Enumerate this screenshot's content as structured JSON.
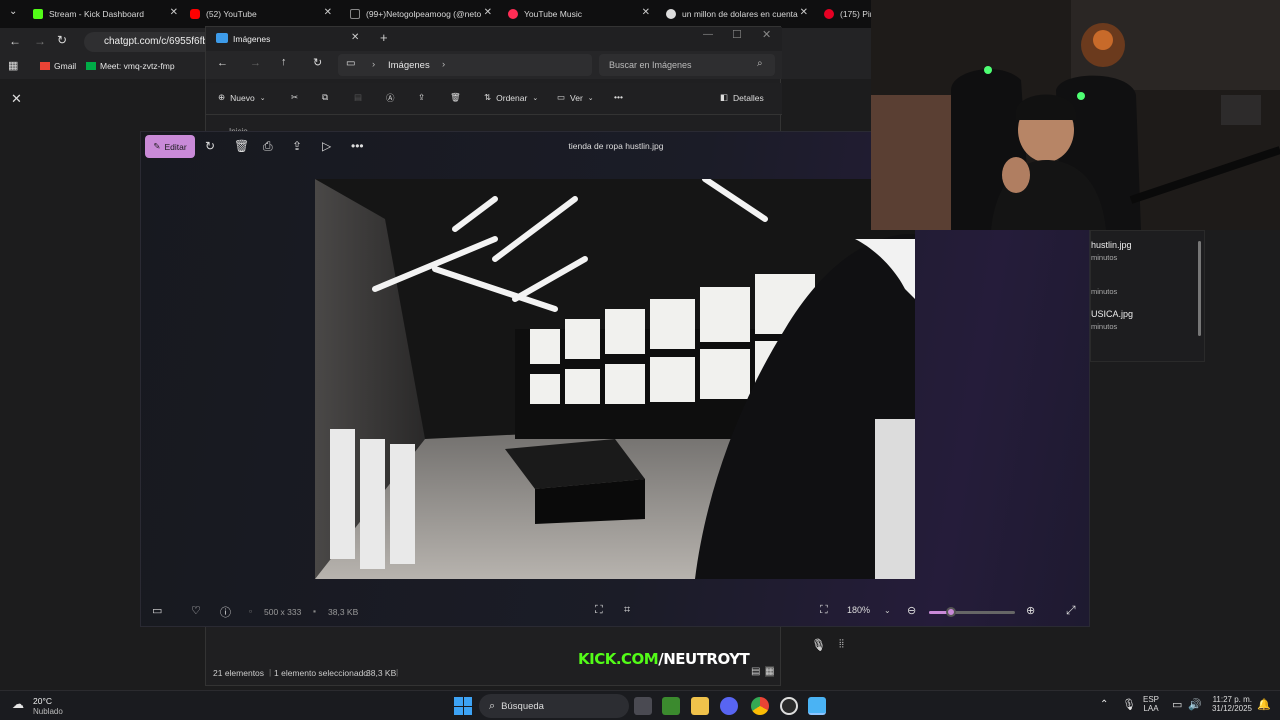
{
  "browser": {
    "tabs": [
      {
        "title": "Stream - Kick Dashboard",
        "color": "#53fc18"
      },
      {
        "title": "(52) YouTube",
        "color": "#ff0000"
      },
      {
        "title": "(99+)Netogolpeamoog (@neto",
        "color": "#ffffff"
      },
      {
        "title": "YouTube Music",
        "color": "#ff2d55"
      },
      {
        "title": "un millon de dolares en cuenta",
        "color": "#dddddd"
      },
      {
        "title": "(175) Pin",
        "color": "#e60023"
      }
    ],
    "url": "chatgpt.com/c/6955f6fb",
    "bookmarks": [
      "Gmail",
      "Meet: vmq-zvtz-fmp"
    ]
  },
  "explorer": {
    "title": "Imágenes",
    "breadcrumb": "Imágenes",
    "search_placeholder": "Buscar en Imágenes",
    "commands": {
      "new": "Nuevo",
      "sort": "Ordenar",
      "view": "Ver",
      "details": "Detalles"
    },
    "partial_item": "Inicio",
    "status_count": "21 elementos",
    "status_selected": "1 elemento seleccionado",
    "status_size": "38,3 KB"
  },
  "photos": {
    "edit_label": "Editar",
    "filename": "tienda de ropa hustlin.jpg",
    "dimensions": "500 x 333",
    "filesize": "38,3 KB",
    "zoom": "180%",
    "zoom_level": 0.25
  },
  "side_list": {
    "items": [
      {
        "name": "hustlin.jpg",
        "meta": "minutos"
      },
      {
        "name": "",
        "meta": "minutos"
      },
      {
        "name": "USICA.jpg",
        "meta": "minutos"
      }
    ]
  },
  "overlay": {
    "kick_a": "KICK.COM",
    "kick_b": "/NEUTROYT"
  },
  "taskbar": {
    "weather_temp": "20°C",
    "weather_desc": "Nublado",
    "search": "Búsqueda",
    "lang_a": "ESP",
    "lang_b": "LAA",
    "time": "11:27 p. m.",
    "date": "31/12/2025"
  }
}
